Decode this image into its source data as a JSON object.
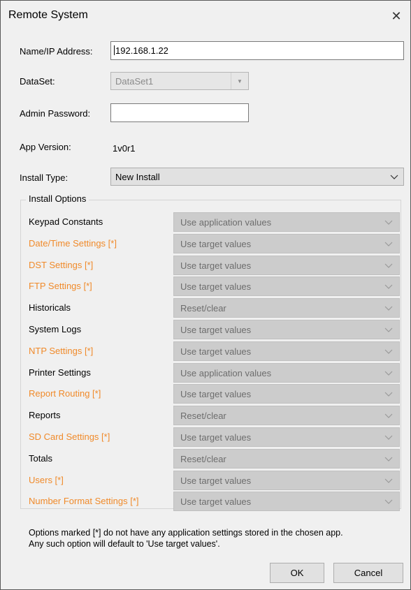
{
  "window": {
    "title": "Remote System",
    "close_glyph": "✕"
  },
  "fields": {
    "name_label": "Name/IP Address:",
    "name_value": "192.168.1.22",
    "dataset_label": "DataSet:",
    "dataset_value": "DataSet1",
    "admin_label": "Admin Password:",
    "admin_value": "",
    "version_label": "App Version:",
    "version_value": "1v0r1",
    "install_type_label": "Install Type:",
    "install_type_value": "New Install"
  },
  "install_options": {
    "title": "Install Options",
    "rows": [
      {
        "label": "Keypad Constants",
        "value": "Use application values",
        "orange": false
      },
      {
        "label": "Date/Time Settings [*]",
        "value": "Use target values",
        "orange": true
      },
      {
        "label": "DST Settings [*]",
        "value": "Use target values",
        "orange": true
      },
      {
        "label": "FTP Settings [*]",
        "value": "Use target values",
        "orange": true
      },
      {
        "label": "Historicals",
        "value": "Reset/clear",
        "orange": false
      },
      {
        "label": "System Logs",
        "value": "Use target values",
        "orange": false
      },
      {
        "label": "NTP Settings [*]",
        "value": "Use target values",
        "orange": true
      },
      {
        "label": "Printer Settings",
        "value": "Use application values",
        "orange": false
      },
      {
        "label": "Report Routing [*]",
        "value": "Use target values",
        "orange": true
      },
      {
        "label": "Reports",
        "value": "Reset/clear",
        "orange": false
      },
      {
        "label": "SD Card Settings [*]",
        "value": "Use target values",
        "orange": true
      },
      {
        "label": "Totals",
        "value": "Reset/clear",
        "orange": false
      },
      {
        "label": "Users [*]",
        "value": "Use target values",
        "orange": true
      },
      {
        "label": "Number Format Settings [*]",
        "value": "Use target values",
        "orange": true
      }
    ]
  },
  "note": {
    "line1": "Options marked [*] do not have any application settings stored in the chosen app.",
    "line2": "Any such option will default to 'Use target values'."
  },
  "buttons": {
    "ok": "OK",
    "cancel": "Cancel"
  },
  "colors": {
    "orange_label": "#f08a2a",
    "dialog_bg": "#f0f0f0"
  }
}
